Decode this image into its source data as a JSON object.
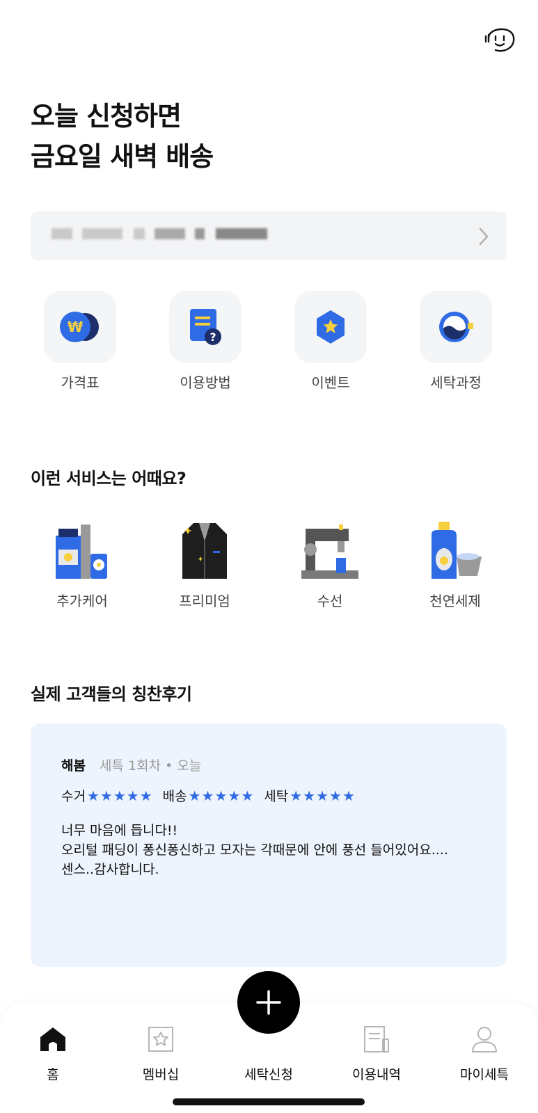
{
  "header": {
    "support_icon": "smile-face-icon",
    "headline_line1": "오늘 신청하면",
    "headline_line2": "금요일 새벽 배송"
  },
  "address_bar": {
    "redacted": true,
    "chevron_icon": "chevron-right-icon"
  },
  "quick_menu": [
    {
      "label": "가격표",
      "icon": "won-coin-icon"
    },
    {
      "label": "이용방법",
      "icon": "guide-doc-icon"
    },
    {
      "label": "이벤트",
      "icon": "star-badge-icon"
    },
    {
      "label": "세탁과정",
      "icon": "washing-drum-icon"
    }
  ],
  "services": {
    "title": "이런 서비스는 어때요?",
    "items": [
      {
        "label": "추가케어",
        "icon": "care-products-icon"
      },
      {
        "label": "프리미엄",
        "icon": "premium-jacket-icon"
      },
      {
        "label": "수선",
        "icon": "sewing-machine-icon"
      },
      {
        "label": "천연세제",
        "icon": "detergent-bottle-icon"
      }
    ]
  },
  "reviews": {
    "title": "실제 고객들의 칭찬후기",
    "items": [
      {
        "name": "해봄",
        "meta": "세특 1회차 • 오늘",
        "ratings": [
          {
            "label": "수거",
            "stars": "★★★★★",
            "value": 5
          },
          {
            "label": "배송",
            "stars": "★★★★★",
            "value": 5
          },
          {
            "label": "세탁",
            "stars": "★★★★★",
            "value": 5
          }
        ],
        "text_line1": "너무 마음에 듭니다!!",
        "text_line2": "오리털 패딩이 퐁신퐁신하고 모자는 각때문에 안에 풍선 들어있어요....",
        "text_line3": "센스..감사합니다."
      }
    ]
  },
  "tab_bar": {
    "items": [
      {
        "label": "홈",
        "icon": "home-icon",
        "active": true
      },
      {
        "label": "멤버십",
        "icon": "membership-icon",
        "active": false
      },
      {
        "label": "세탁신청",
        "icon": "plus-icon",
        "active": false
      },
      {
        "label": "이용내역",
        "icon": "history-icon",
        "active": false
      },
      {
        "label": "마이세특",
        "icon": "profile-icon",
        "active": false
      }
    ]
  },
  "colors": {
    "accent_blue": "#2f6be4",
    "review_bg": "#eef4fd",
    "tile_bg": "#f4f5f7",
    "star_yellow": "#f7cf3c"
  }
}
